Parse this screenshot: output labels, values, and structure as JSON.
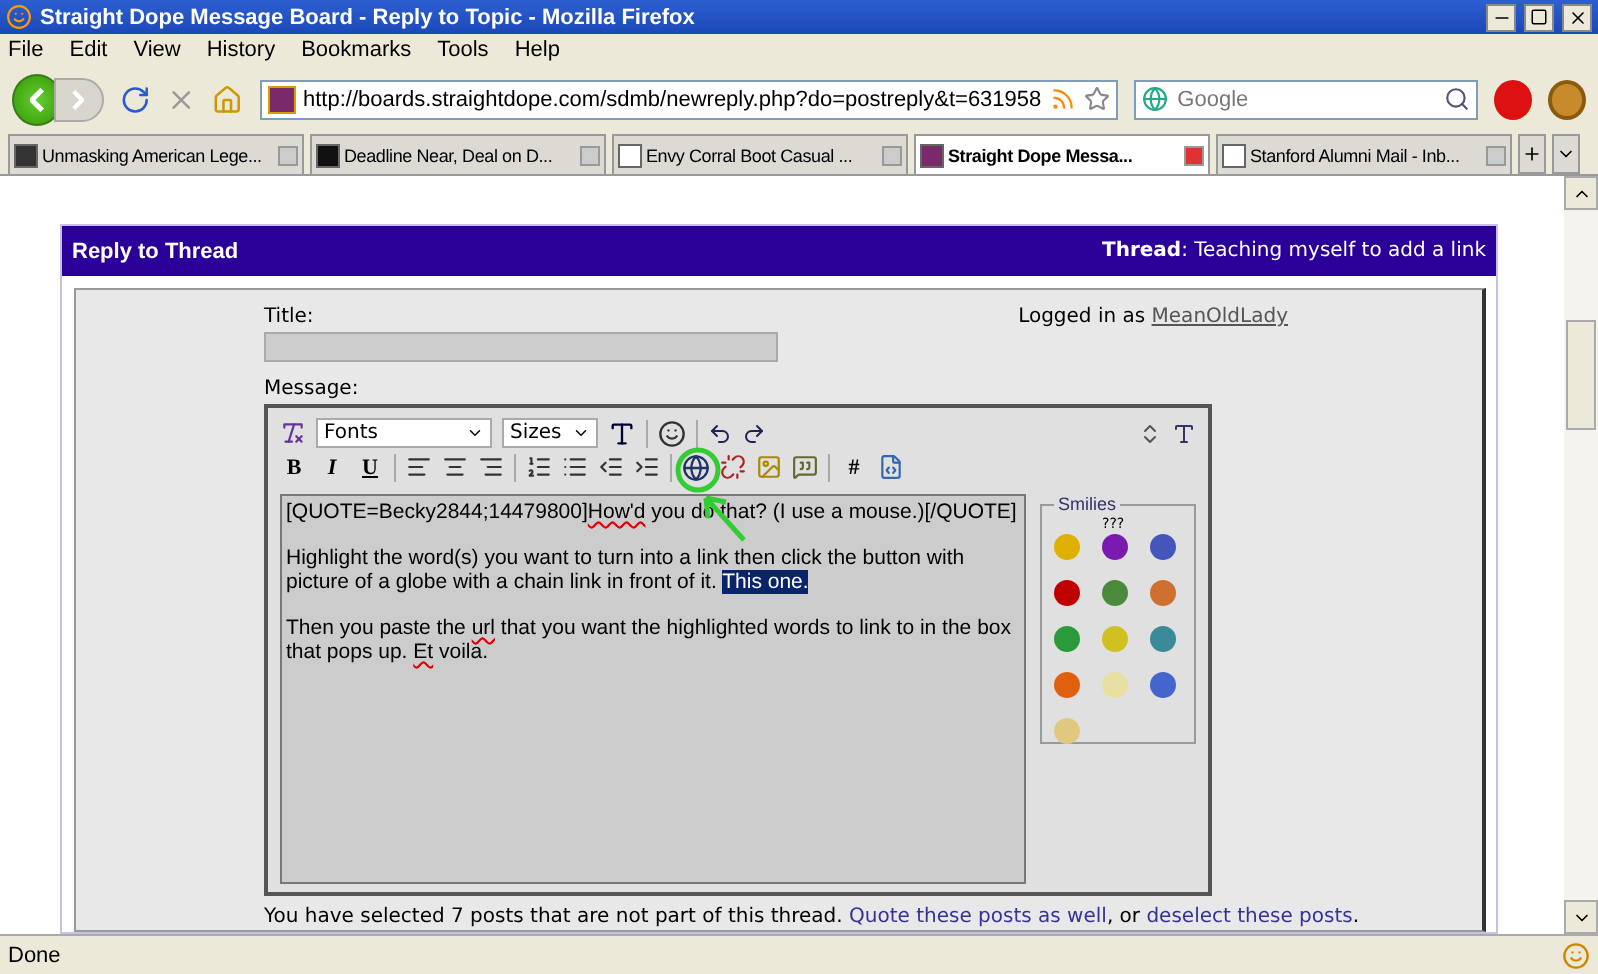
{
  "window": {
    "title": "Straight Dope Message Board - Reply to Topic - Mozilla Firefox"
  },
  "menu": [
    {
      "label": "File"
    },
    {
      "label": "Edit"
    },
    {
      "label": "View"
    },
    {
      "label": "History"
    },
    {
      "label": "Bookmarks"
    },
    {
      "label": "Tools"
    },
    {
      "label": "Help"
    }
  ],
  "address_bar": {
    "value": "http://boards.straightdope.com/sdmb/newreply.php?do=postreply&t=631958"
  },
  "search": {
    "placeholder": "Google"
  },
  "tabs": [
    {
      "label": "Unmasking American Lege...",
      "selected": false
    },
    {
      "label": "Deadline Near, Deal on D...",
      "selected": false
    },
    {
      "label": "Envy Corral Boot Casual ...",
      "selected": false
    },
    {
      "label": "Straight Dope Messa...",
      "selected": true
    },
    {
      "label": "Stanford Alumni Mail - Inb...",
      "selected": false
    }
  ],
  "panel": {
    "title": "Reply to Thread",
    "thread_label": "Thread",
    "thread_title": ": Teaching myself to add a link"
  },
  "form": {
    "title_label": "Title:",
    "logged_in": "Logged in as",
    "user": "MeanOldLady",
    "message_label": "Message:"
  },
  "editor": {
    "font_select": "Fonts",
    "size_select": "Sizes",
    "format_buttons": [
      "B",
      "I",
      "U"
    ],
    "hash_button": "#",
    "message": [
      [
        {
          "kind": "text",
          "text": "[QUOTE=Becky2844;14479800]"
        },
        {
          "kind": "misspelled",
          "text": "How'd"
        },
        {
          "kind": "text",
          "text": " you do that?  (I use a mouse.)[/QUOTE]"
        }
      ],
      [
        {
          "kind": "text",
          "text": "Highlight the word(s) you want to turn into a link then click the button with picture of a globe with a chain link in front of it. "
        },
        {
          "kind": "selected",
          "text": "This one."
        }
      ],
      [
        {
          "kind": "text",
          "text": "Then you paste the "
        },
        {
          "kind": "misspelled",
          "text": "url"
        },
        {
          "kind": "text",
          "text": " that you want the highlighted words to link to in the box that pops up. "
        },
        {
          "kind": "misspelled",
          "text": "Et"
        },
        {
          "kind": "text",
          "text": " voila."
        }
      ]
    ],
    "smilies_legend": "Smilies",
    "smiley_caption": "???"
  },
  "notice": {
    "text": "You have selected 7 posts that are not part of this thread. ",
    "link1": "Quote these posts as well",
    "middle": ", or ",
    "link2": "deselect these posts",
    "end": "."
  },
  "status_bar": {
    "text": "Done"
  }
}
